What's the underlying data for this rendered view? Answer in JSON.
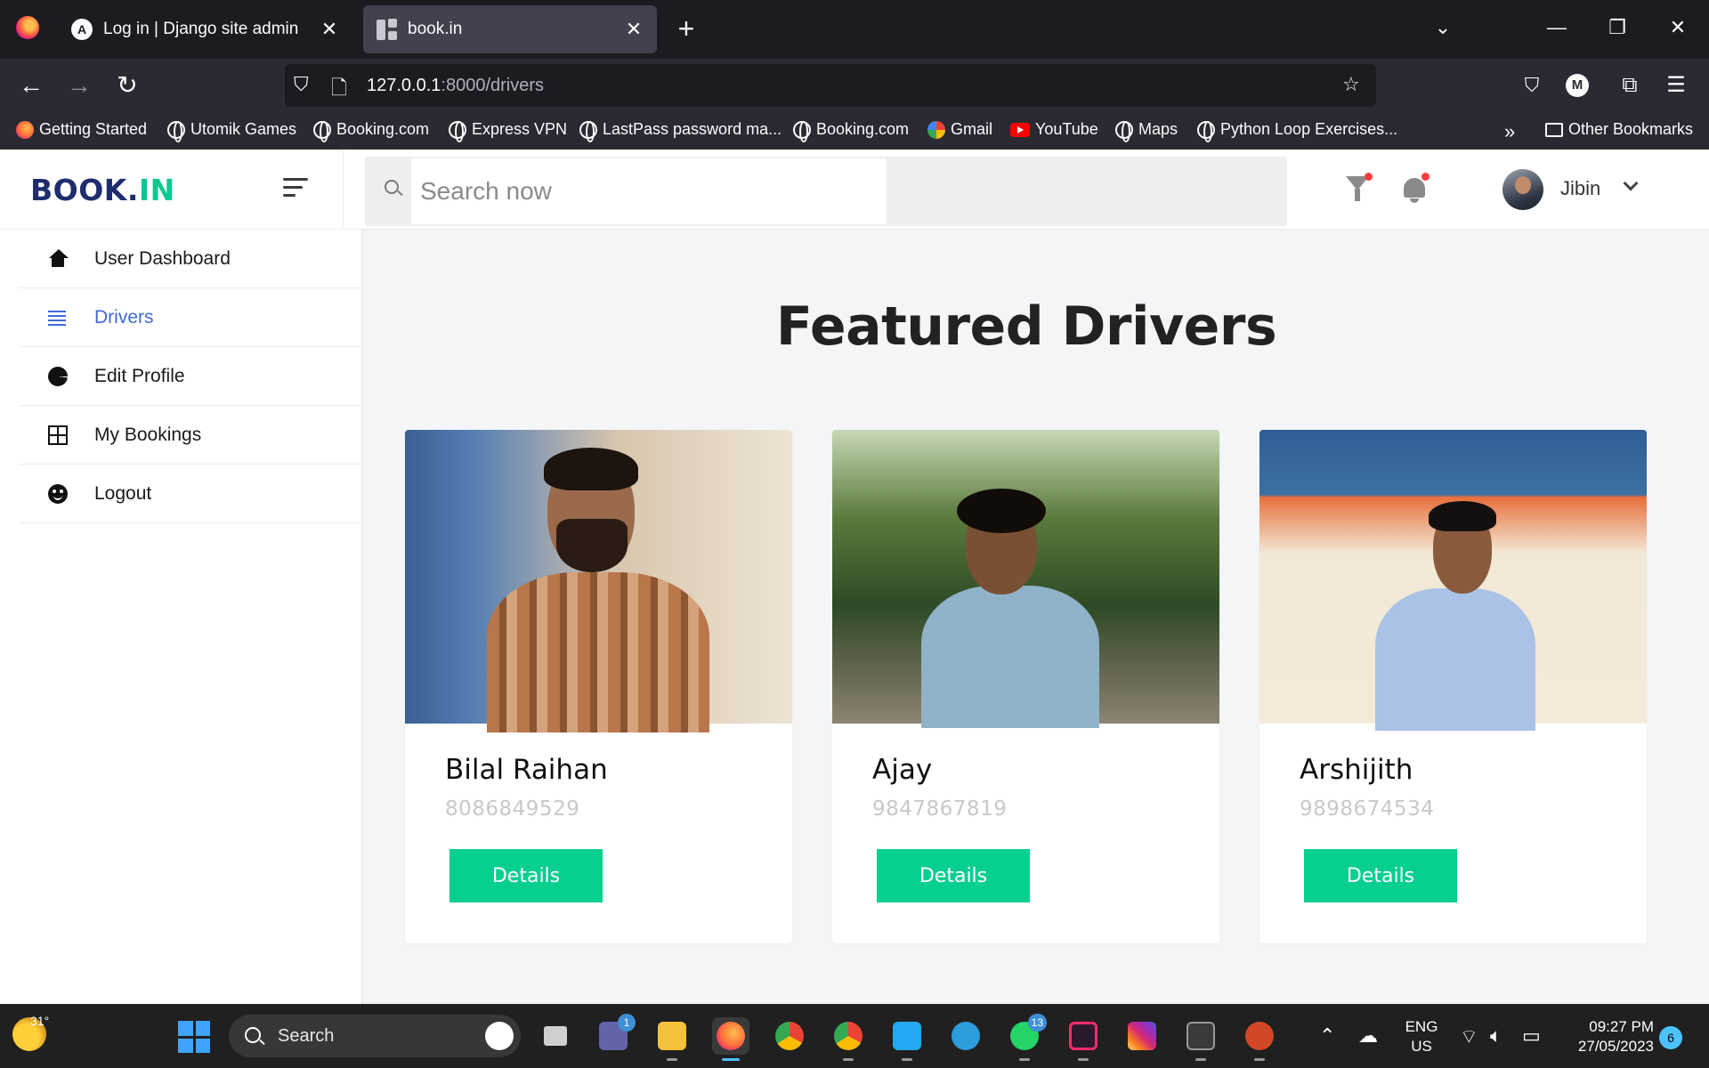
{
  "browser": {
    "tabs": [
      {
        "title": "Log in | Django site admin",
        "active": false
      },
      {
        "title": "book.in",
        "active": true
      }
    ],
    "url": {
      "host": "127.0.0.1",
      "path": ":8000/drivers"
    },
    "bookmarks": [
      "Getting Started",
      "Utomik Games",
      "Booking.com",
      "Express VPN",
      "LastPass password ma...",
      "Booking.com",
      "Gmail",
      "YouTube",
      "Maps",
      "Python Loop Exercises..."
    ],
    "other_bookmarks": "Other Bookmarks"
  },
  "app": {
    "logo_main": "BOOK.",
    "logo_accent": "IN",
    "search_placeholder": "Search now",
    "user_name": "Jibin"
  },
  "sidebar": {
    "items": [
      {
        "label": "User Dashboard",
        "icon": "home-icon"
      },
      {
        "label": "Drivers",
        "icon": "list-icon",
        "active": true
      },
      {
        "label": "Edit Profile",
        "icon": "pie-chart-icon"
      },
      {
        "label": "My Bookings",
        "icon": "grid-icon"
      },
      {
        "label": "Logout",
        "icon": "smile-icon"
      }
    ]
  },
  "main": {
    "title": "Featured Drivers",
    "drivers": [
      {
        "name": "Bilal Raihan",
        "phone": "8086849529",
        "button": "Details"
      },
      {
        "name": "Ajay",
        "phone": "9847867819",
        "button": "Details"
      },
      {
        "name": "Arshijith",
        "phone": "9898674534",
        "button": "Details"
      }
    ]
  },
  "taskbar": {
    "weather_temp": "31°",
    "search_label": "Search",
    "teams_badge": "1",
    "whatsapp_badge": "13",
    "lang_line1": "ENG",
    "lang_line2": "US",
    "time": "09:27 PM",
    "date": "27/05/2023",
    "notifications": "6"
  },
  "colors": {
    "accent_green": "#06cf8f",
    "logo_navy": "#1f2d6e",
    "active_blue": "#3f6ad8"
  }
}
